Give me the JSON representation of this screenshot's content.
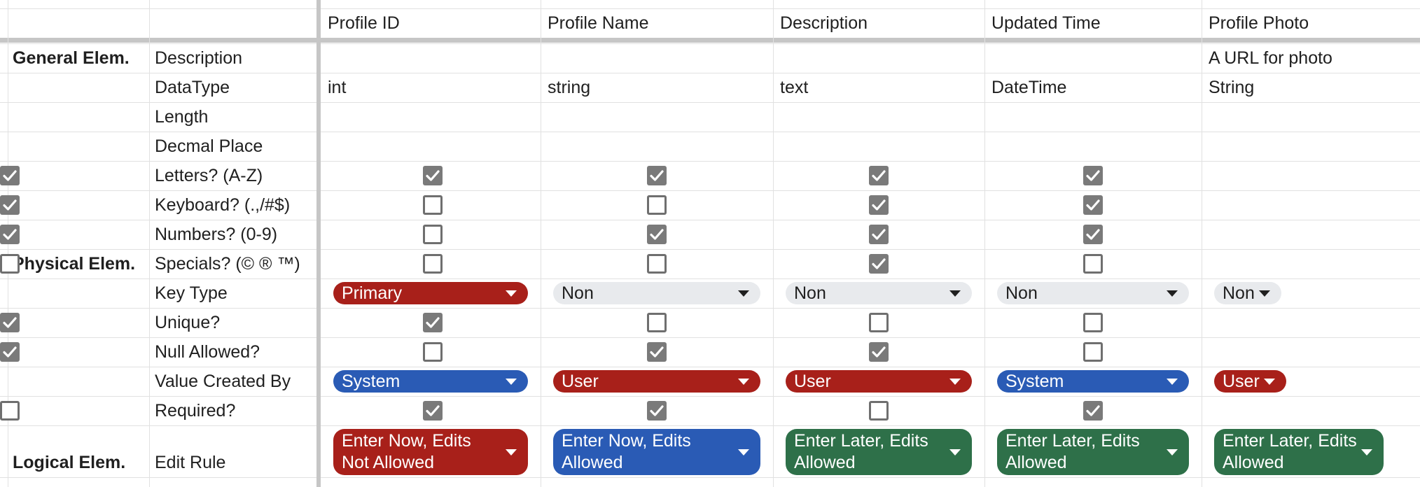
{
  "columns": [
    "Profile ID",
    "Profile Name",
    "Description",
    "Updated Time",
    "Profile Photo"
  ],
  "groups": [
    {
      "label": "General Elem.",
      "row": 0
    },
    {
      "label": "Physical Elem.",
      "row": 7
    },
    {
      "label": "Logical Elem.",
      "row": 13
    }
  ],
  "rows": [
    {
      "label": "Description",
      "kind": "text",
      "values": [
        "",
        "",
        "",
        "",
        "A URL for photo"
      ]
    },
    {
      "label": "DataType",
      "kind": "text",
      "values": [
        "int",
        "string",
        "text",
        "DateTime",
        "String"
      ]
    },
    {
      "label": "Length",
      "kind": "text",
      "values": [
        "",
        "",
        "",
        "",
        ""
      ]
    },
    {
      "label": "Decmal Place",
      "kind": "text",
      "values": [
        "",
        "",
        "",
        "",
        ""
      ]
    },
    {
      "label": "Letters? (A-Z)",
      "kind": "check",
      "values": [
        true,
        true,
        true,
        true,
        true
      ]
    },
    {
      "label": "Keyboard? (.,/#$)",
      "kind": "check",
      "values": [
        false,
        false,
        true,
        true,
        true
      ]
    },
    {
      "label": "Numbers? (0-9)",
      "kind": "check",
      "values": [
        false,
        true,
        true,
        true,
        true
      ]
    },
    {
      "label": "Specials? (© ® ™)",
      "kind": "check",
      "values": [
        false,
        false,
        true,
        false,
        false
      ]
    },
    {
      "label": "Key Type",
      "kind": "chip",
      "values": [
        "Primary",
        "Non",
        "Non",
        "Non",
        "Non"
      ]
    },
    {
      "label": "Unique?",
      "kind": "check",
      "values": [
        true,
        false,
        false,
        false,
        true
      ]
    },
    {
      "label": "Null Allowed?",
      "kind": "check",
      "values": [
        false,
        true,
        true,
        false,
        true
      ]
    },
    {
      "label": "Value Created By",
      "kind": "chip",
      "values": [
        "System",
        "User",
        "User",
        "System",
        "User"
      ]
    },
    {
      "label": "Required?",
      "kind": "check",
      "values": [
        true,
        true,
        false,
        true,
        false
      ]
    },
    {
      "label": "Edit Rule",
      "kind": "chip",
      "values": [
        "Enter Now, Edits\nNot Allowed",
        "Enter Now, Edits\nAllowed",
        "Enter Later, Edits\nAllowed",
        "Enter Later, Edits\nAllowed",
        "Enter Later, Edits\nAllowed"
      ]
    }
  ],
  "chip_colors": {
    "Primary": "#a8201a",
    "Non": "#e8eaed",
    "System": "#2a5bb5",
    "User": "#a8201a",
    "Enter Now, Edits\nNot Allowed": "#a8201a",
    "Enter Now, Edits\nAllowed": "#2a5bb5",
    "Enter Later, Edits\nAllowed": "#2e7049"
  },
  "chip_text_colors": {
    "Non": "#1f1f1f"
  }
}
